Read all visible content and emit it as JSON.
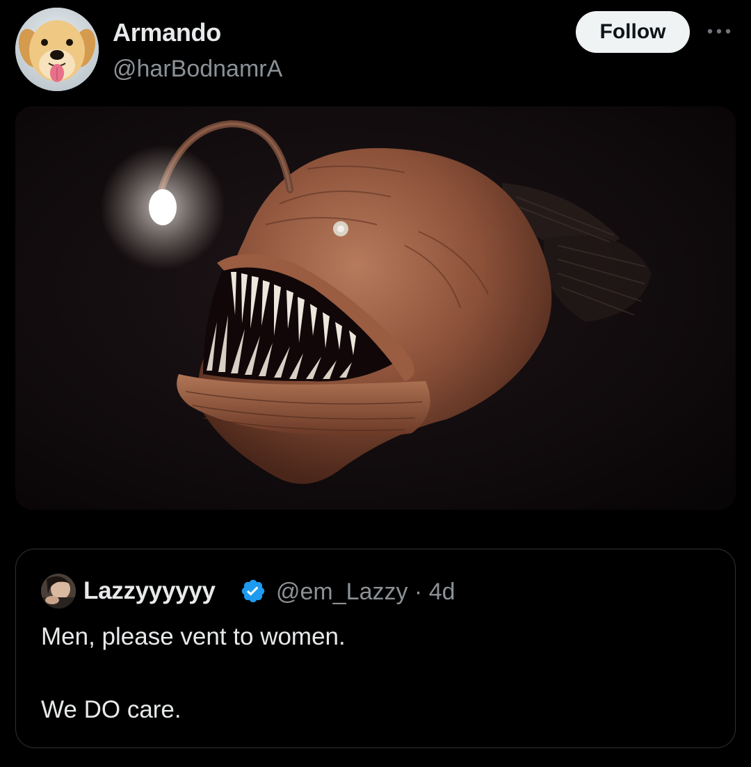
{
  "tweet": {
    "author_name": "Armando",
    "author_handle": "@harBodnamrA",
    "follow_label": "Follow",
    "more_icon": "more-horizontal-icon",
    "media_icon": "anglerfish-image"
  },
  "quoted_tweet": {
    "author_name": "Lazzyyyyyy",
    "verified_icon": "verified-badge-icon",
    "verified_color": "#1d9bf0",
    "handle_and_time": "@em_Lazzy · 4d",
    "text_line_1": "Men, please vent to women.",
    "text_line_2": "We DO care."
  },
  "colors": {
    "background": "#000000",
    "primary_text": "#e7e9ea",
    "secondary_text": "#8b9196",
    "follow_button_bg": "#eff3f4"
  }
}
